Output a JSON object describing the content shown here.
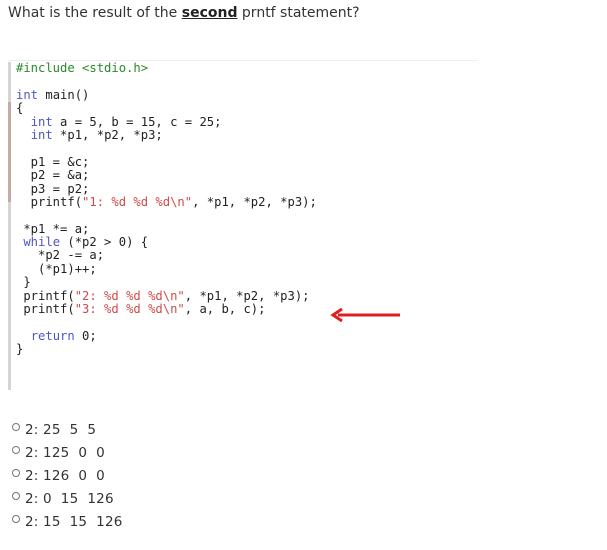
{
  "question": {
    "prefix": "What is the result of the ",
    "emphasis": "second",
    "suffix": " prntf statement?"
  },
  "code": {
    "lines": [
      {
        "parts": [
          {
            "t": "#include <stdio.h>",
            "c": "pp"
          }
        ]
      },
      {
        "parts": [
          {
            "t": ""
          }
        ]
      },
      {
        "parts": [
          {
            "t": "int",
            "c": "kw"
          },
          {
            "t": " main()"
          }
        ]
      },
      {
        "parts": [
          {
            "t": "{"
          }
        ]
      },
      {
        "parts": [
          {
            "t": "  "
          },
          {
            "t": "int",
            "c": "kw"
          },
          {
            "t": " a = 5, b = 15, c = 25;"
          }
        ]
      },
      {
        "parts": [
          {
            "t": "  "
          },
          {
            "t": "int",
            "c": "kw"
          },
          {
            "t": " *p1, *p2, *p3;"
          }
        ]
      },
      {
        "parts": [
          {
            "t": ""
          }
        ]
      },
      {
        "parts": [
          {
            "t": "  p1 = &c;"
          }
        ]
      },
      {
        "parts": [
          {
            "t": "  p2 = &a;"
          }
        ]
      },
      {
        "parts": [
          {
            "t": "  p3 = p2;"
          }
        ]
      },
      {
        "parts": [
          {
            "t": "  printf("
          },
          {
            "t": "\"1: %d %d %d\\n\"",
            "c": "str"
          },
          {
            "t": ", *p1, *p2, *p3);"
          }
        ]
      },
      {
        "parts": [
          {
            "t": ""
          }
        ]
      },
      {
        "parts": [
          {
            "t": " *p1 *= a;"
          }
        ]
      },
      {
        "parts": [
          {
            "t": " "
          },
          {
            "t": "while",
            "c": "kw"
          },
          {
            "t": " (*p2 > 0) {"
          }
        ]
      },
      {
        "parts": [
          {
            "t": "   *p2 -= a;"
          }
        ]
      },
      {
        "parts": [
          {
            "t": "   (*p1)++;"
          }
        ]
      },
      {
        "parts": [
          {
            "t": " }"
          }
        ]
      },
      {
        "parts": [
          {
            "t": " printf("
          },
          {
            "t": "\"2: %d %d %d\\n\"",
            "c": "str"
          },
          {
            "t": ", *p1, *p2, *p3);"
          }
        ]
      },
      {
        "parts": [
          {
            "t": " printf("
          },
          {
            "t": "\"3: %d %d %d\\n\"",
            "c": "str"
          },
          {
            "t": ", a, b, c);"
          }
        ]
      },
      {
        "parts": [
          {
            "t": ""
          }
        ]
      },
      {
        "parts": [
          {
            "t": "  "
          },
          {
            "t": "return",
            "c": "kw"
          },
          {
            "t": " 0;"
          }
        ]
      },
      {
        "parts": [
          {
            "t": "}"
          }
        ]
      }
    ]
  },
  "annotation": {
    "arrow": "left-arrow-icon",
    "arrow_color": "#e02020",
    "points_to_line": 18
  },
  "options": [
    {
      "label": "2: 25  5  5",
      "selected": false
    },
    {
      "label": "2: 125  0  0",
      "selected": false
    },
    {
      "label": "2: 126  0  0",
      "selected": false
    },
    {
      "label": "2: 0  15  126",
      "selected": false
    },
    {
      "label": "2: 15  15  126",
      "selected": false
    }
  ]
}
